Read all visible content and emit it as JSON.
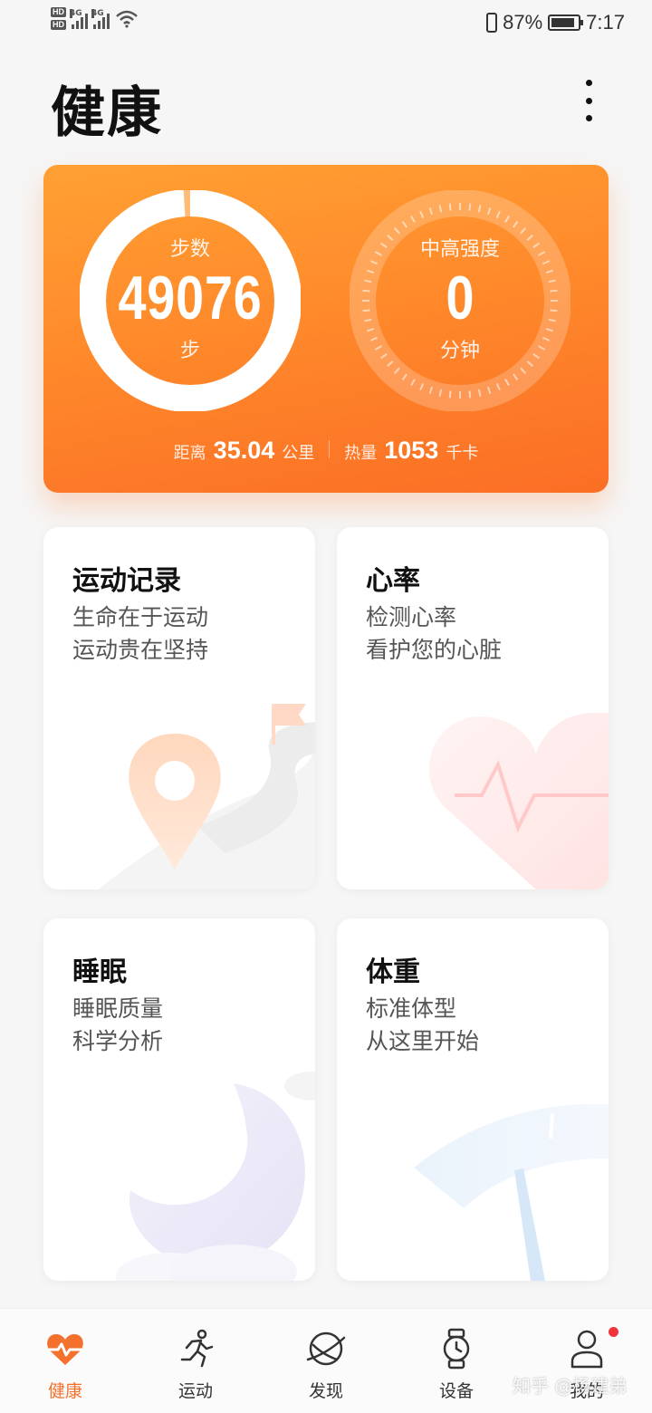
{
  "status_bar": {
    "hd1": "HD",
    "hd2": "HD",
    "net1": "4G",
    "net2": "4G",
    "battery_pct": "87%",
    "battery_level": 0.87,
    "time": "7:17"
  },
  "header": {
    "title": "健康"
  },
  "hero": {
    "steps_label": "步数",
    "steps_value": "49076",
    "steps_unit": "步",
    "steps_goal_progress": 0.99,
    "intensity_label": "中高强度",
    "intensity_value": "0",
    "intensity_unit": "分钟",
    "distance_label": "距离",
    "distance_value": "35.04",
    "distance_unit": "公里",
    "calories_label": "热量",
    "calories_value": "1053",
    "calories_unit": "千卡"
  },
  "tiles": [
    {
      "title": "运动记录",
      "line1": "生命在于运动",
      "line2": "运动贵在坚持",
      "icon": "map-pin-icon"
    },
    {
      "title": "心率",
      "line1": "检测心率",
      "line2": "看护您的心脏",
      "icon": "heart-icon"
    },
    {
      "title": "睡眠",
      "line1": "睡眠质量",
      "line2": "科学分析",
      "icon": "moon-icon"
    },
    {
      "title": "体重",
      "line1": "标准体型",
      "line2": "从这里开始",
      "icon": "scale-gauge-icon"
    }
  ],
  "nav": [
    {
      "label": "健康",
      "icon": "heart-pulse-icon",
      "active": true
    },
    {
      "label": "运动",
      "icon": "runner-icon",
      "active": false
    },
    {
      "label": "发现",
      "icon": "planet-icon",
      "active": false
    },
    {
      "label": "设备",
      "icon": "watch-icon",
      "active": false
    },
    {
      "label": "我的",
      "icon": "person-icon",
      "active": false,
      "badge": true
    }
  ],
  "watermark": "知乎 @杨建弟",
  "colors": {
    "accent": "#f4702d",
    "hero_top": "#ffa033",
    "hero_bottom": "#fb6e25",
    "badge": "#f0343c"
  }
}
